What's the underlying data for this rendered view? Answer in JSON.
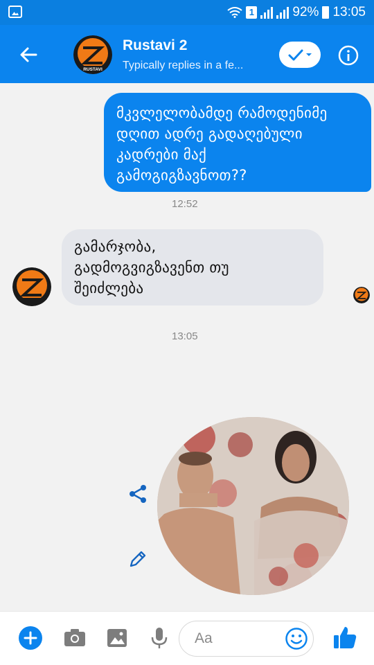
{
  "status_bar": {
    "sim": "1",
    "battery": "92%",
    "time": "13:05"
  },
  "header": {
    "title": "Rustavi 2",
    "subtitle": "Typically replies in a fe...",
    "avatar_label": "RUSTAVI"
  },
  "messages": [
    {
      "direction": "outgoing",
      "lines": [
        "მკვლელობამდე რამოდენიმე",
        "დღით ადრე გადაღებული",
        "კადრები მაქ",
        "გამოგიგზავნოთ??"
      ]
    },
    {
      "direction": "incoming",
      "lines": [
        "გამარჯობა,",
        "გადმოგვიგზავენთ თუ",
        "შეიძლება"
      ]
    }
  ],
  "timestamps": [
    "12:52",
    "13:05"
  ],
  "composer": {
    "placeholder": "Aa"
  },
  "colors": {
    "brand_blue": "#0b84ee",
    "status_blue": "#0b7fe0",
    "incoming_bubble": "#e4e6eb",
    "logo_orange": "#f07a16"
  },
  "icons": [
    "back-arrow-icon",
    "check-icon",
    "chevron-down-icon",
    "info-icon",
    "share-icon",
    "pencil-icon",
    "plus-icon",
    "camera-icon",
    "image-icon",
    "microphone-icon",
    "emoji-icon",
    "thumbs-up-icon"
  ]
}
